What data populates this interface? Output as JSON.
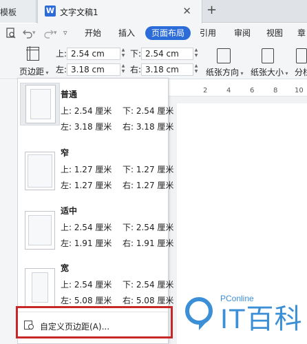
{
  "tabs": {
    "left_tab_label": "模板",
    "doc_icon_glyph": "W",
    "active_tab_title": "文字文稿1",
    "close_glyph": "✕",
    "add_glyph": "+"
  },
  "menu": {
    "quick_icons": [
      "preview-icon",
      "undo-icon",
      "redo-icon",
      "customize-icon"
    ],
    "items": [
      "开始",
      "插入",
      "页面布局",
      "引用",
      "审阅",
      "视图",
      "章"
    ],
    "active_index": 2,
    "accent_color": "#2c6cd9"
  },
  "toolbar": {
    "margins_button_label": "页边距",
    "top_label": "上:",
    "top_value": "2.54 cm",
    "bottom_label": "下:",
    "bottom_value": "2.54 cm",
    "left_label": "左:",
    "left_value": "3.18 cm",
    "right_label": "右:",
    "right_value": "3.18 cm",
    "orientation_label": "纸张方向",
    "size_label": "纸张大小",
    "columns_label": "分栏"
  },
  "ruler": {
    "ticks": [
      "2",
      "4",
      "6",
      "8",
      "10"
    ]
  },
  "presets": [
    {
      "name": "普通",
      "top": "上: 2.54 厘米",
      "bottom": "下: 2.54 厘米",
      "left": "左: 3.18 厘米",
      "right": "右: 3.18 厘米",
      "selected": true
    },
    {
      "name": "窄",
      "top": "上: 1.27 厘米",
      "bottom": "下: 1.27 厘米",
      "left": "左: 1.27 厘米",
      "right": "右: 1.27 厘米",
      "selected": false
    },
    {
      "name": "适中",
      "top": "上: 2.54 厘米",
      "bottom": "下: 2.54 厘米",
      "left": "左: 1.91 厘米",
      "right": "右: 1.91 厘米",
      "selected": false
    },
    {
      "name": "宽",
      "top": "上: 2.54 厘米",
      "bottom": "下: 2.54 厘米",
      "left": "左: 5.08 厘米",
      "right": "右: 5.08 厘米",
      "selected": false
    }
  ],
  "custom": {
    "label": "自定义页边距(A)..."
  },
  "watermark": {
    "small": "PConline",
    "big": "IT百科",
    "color": "#3b8fd6"
  },
  "highlight_color": "#c62828"
}
